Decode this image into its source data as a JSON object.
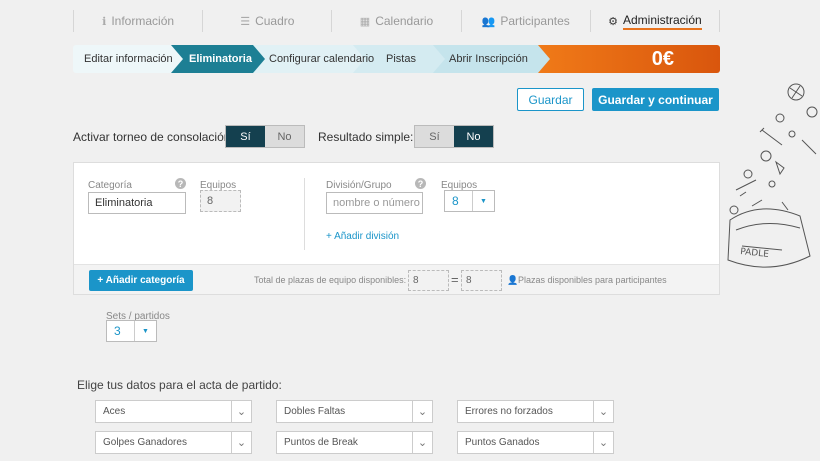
{
  "tabs": [
    {
      "label": "Información",
      "icon": "info-icon",
      "active": false
    },
    {
      "label": "Cuadro",
      "icon": "list-icon",
      "active": false
    },
    {
      "label": "Calendario",
      "icon": "calendar-icon",
      "active": false
    },
    {
      "label": "Participantes",
      "icon": "users-icon",
      "active": false
    },
    {
      "label": "Administración",
      "icon": "gear-icon",
      "active": true
    }
  ],
  "steps": [
    {
      "label": "Editar información"
    },
    {
      "label": "Eliminatoria"
    },
    {
      "label": "Configurar calendario"
    },
    {
      "label": "Pistas"
    },
    {
      "label": "Abrir Inscripción"
    }
  ],
  "price": "0€",
  "actions": {
    "save": "Guardar",
    "save_continue": "Guardar y continuar"
  },
  "consolation": {
    "label": "Activar torneo de consolación:",
    "yes": "Sí",
    "no": "No",
    "selected": "yes"
  },
  "simple_result": {
    "label": "Resultado simple:",
    "yes": "Sí",
    "no": "No",
    "selected": "no"
  },
  "category": {
    "label": "Categoría",
    "value": "Eliminatoria",
    "teams_label": "Equipos",
    "teams_value": "8"
  },
  "division": {
    "label": "División/Grupo",
    "placeholder": "nombre o número",
    "teams_label": "Equipos",
    "teams_value": "8",
    "add_label": "+ Añadir división"
  },
  "footer": {
    "add_category": "+ Añadir categoría",
    "total_label": "Total de plazas de equipo disponibles:",
    "total_value": "8",
    "equals": "=",
    "available_value": "8",
    "available_label": "Plazas disponibles para participantes"
  },
  "sets": {
    "label": "Sets / partidos",
    "value": "3"
  },
  "acta": {
    "label": "Elige tus datos para el acta de partido:",
    "options": [
      "Aces",
      "Dobles Faltas",
      "Errores no forzados",
      "Golpes Ganadores",
      "Puntos de Break",
      "Puntos Ganados"
    ]
  },
  "colors": {
    "accent": "#1b95c9",
    "dark_toggle": "#14404f",
    "price_orange": "#e8731e",
    "active_step": "#1d7f94"
  }
}
